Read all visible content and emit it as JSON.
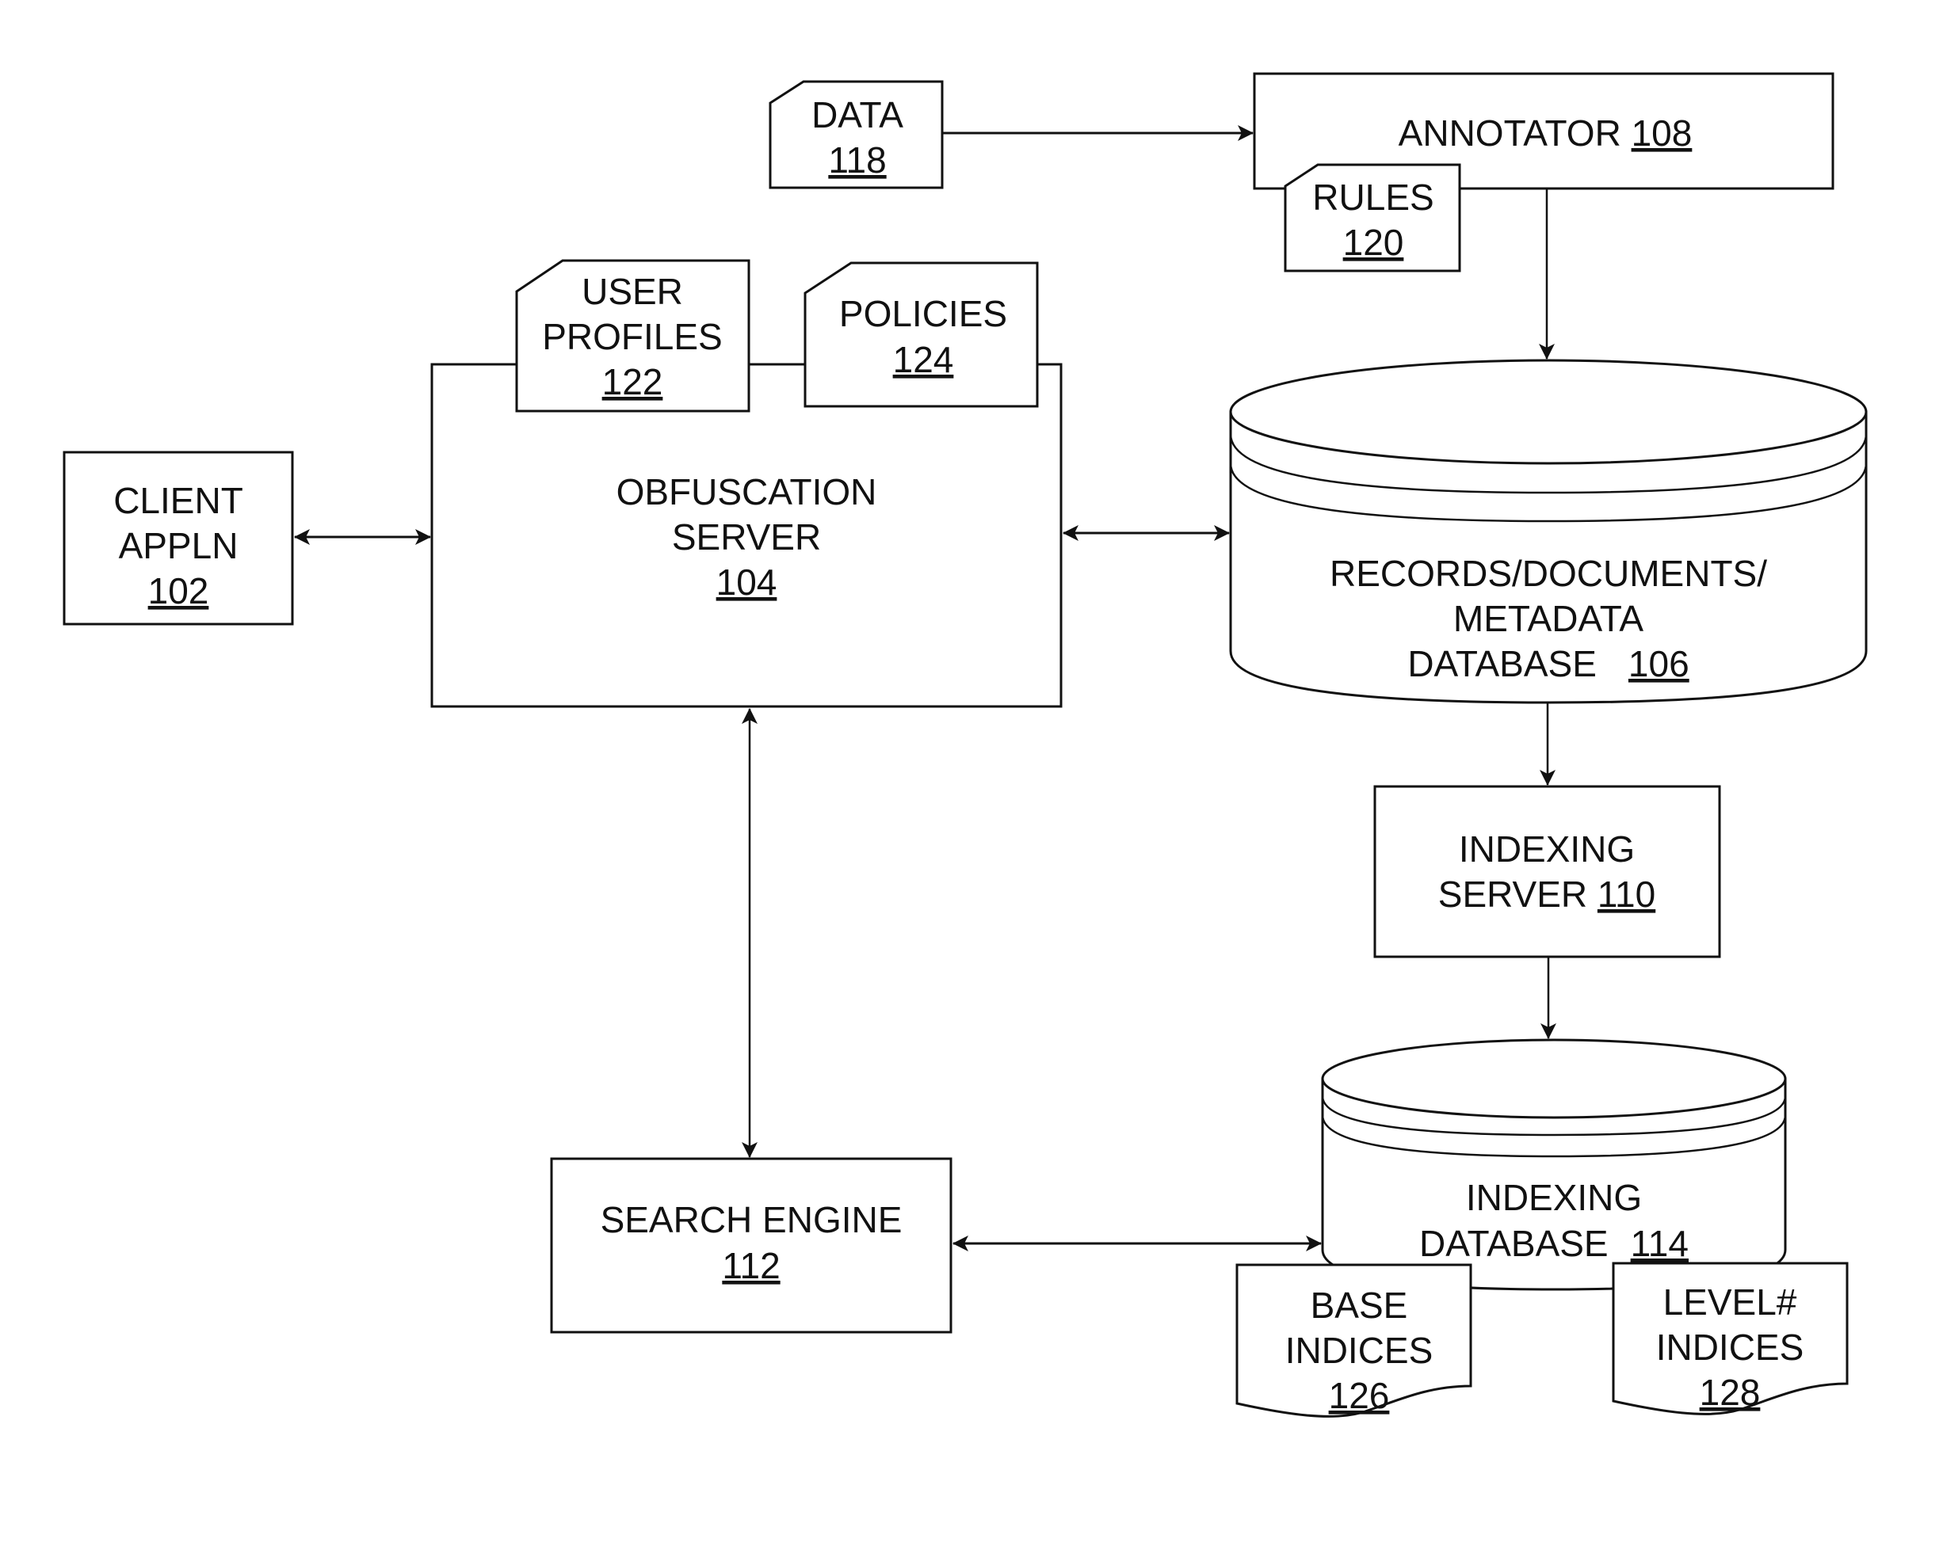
{
  "diagram": {
    "type": "system-architecture-block-diagram",
    "nodes": [
      {
        "id": "client",
        "kind": "box",
        "lines": [
          "CLIENT",
          "APPLN"
        ],
        "ref": "102"
      },
      {
        "id": "obfuscation",
        "kind": "box",
        "lines": [
          "OBFUSCATION",
          "SERVER"
        ],
        "ref": "104"
      },
      {
        "id": "records_db",
        "kind": "database",
        "lines": [
          "RECORDS/DOCUMENTS/",
          "METADATA",
          "DATABASE"
        ],
        "ref": "106"
      },
      {
        "id": "annotator",
        "kind": "box",
        "lines": [
          "ANNOTATOR"
        ],
        "ref": "108"
      },
      {
        "id": "indexing_server",
        "kind": "box",
        "lines": [
          "INDEXING",
          "SERVER"
        ],
        "ref": "110"
      },
      {
        "id": "search_engine",
        "kind": "box",
        "lines": [
          "SEARCH ENGINE"
        ],
        "ref": "112"
      },
      {
        "id": "indexing_db",
        "kind": "database",
        "lines": [
          "INDEXING",
          "DATABASE"
        ],
        "ref": "114"
      },
      {
        "id": "data",
        "kind": "card",
        "lines": [
          "DATA"
        ],
        "ref": "118"
      },
      {
        "id": "rules",
        "kind": "card",
        "lines": [
          "RULES"
        ],
        "ref": "120"
      },
      {
        "id": "user_profiles",
        "kind": "card",
        "lines": [
          "USER",
          "PROFILES"
        ],
        "ref": "122"
      },
      {
        "id": "policies",
        "kind": "card",
        "lines": [
          "POLICIES"
        ],
        "ref": "124"
      },
      {
        "id": "base_indices",
        "kind": "document",
        "lines": [
          "BASE",
          "INDICES"
        ],
        "ref": "126"
      },
      {
        "id": "level_indices",
        "kind": "document",
        "lines": [
          "LEVEL#",
          "INDICES"
        ],
        "ref": "128"
      }
    ],
    "edges": [
      {
        "from": "client",
        "to": "obfuscation",
        "direction": "bidirectional"
      },
      {
        "from": "obfuscation",
        "to": "records_db",
        "direction": "bidirectional"
      },
      {
        "from": "data",
        "to": "annotator",
        "direction": "forward"
      },
      {
        "from": "annotator",
        "to": "records_db",
        "direction": "forward"
      },
      {
        "from": "records_db",
        "to": "indexing_server",
        "direction": "forward"
      },
      {
        "from": "indexing_server",
        "to": "indexing_db",
        "direction": "forward"
      },
      {
        "from": "obfuscation",
        "to": "search_engine",
        "direction": "bidirectional"
      },
      {
        "from": "search_engine",
        "to": "indexing_db",
        "direction": "bidirectional"
      }
    ]
  },
  "labels": {
    "client": {
      "l1": "CLIENT",
      "l2": "APPLN",
      "ref": "102"
    },
    "obfuscation": {
      "l1": "OBFUSCATION",
      "l2": "SERVER",
      "ref": "104"
    },
    "records_db": {
      "l1": "RECORDS/DOCUMENTS/",
      "l2": "METADATA",
      "l3": "DATABASE",
      "ref": "106"
    },
    "annotator": {
      "l1": "ANNOTATOR",
      "ref": "108"
    },
    "indexing_server": {
      "l1": "INDEXING",
      "l2": "SERVER",
      "ref": "110"
    },
    "search_engine": {
      "l1": "SEARCH ENGINE",
      "ref": "112"
    },
    "indexing_db": {
      "l1": "INDEXING",
      "l2": "DATABASE",
      "ref": "114"
    },
    "data": {
      "l1": "DATA",
      "ref": "118"
    },
    "rules": {
      "l1": "RULES",
      "ref": "120"
    },
    "user_profiles": {
      "l1": "USER",
      "l2": "PROFILES",
      "ref": "122"
    },
    "policies": {
      "l1": "POLICIES",
      "ref": "124"
    },
    "base_indices": {
      "l1": "BASE",
      "l2": "INDICES",
      "ref": "126"
    },
    "level_indices": {
      "l1": "LEVEL#",
      "l2": "INDICES",
      "ref": "128"
    }
  },
  "colors": {
    "stroke": "#111111",
    "background": "#ffffff"
  }
}
